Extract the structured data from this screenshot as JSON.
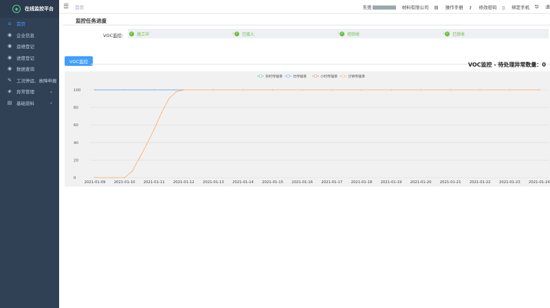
{
  "sidebar": {
    "title": "在线监控平台",
    "items": [
      {
        "label": "首页",
        "icon": "home-icon",
        "active": true
      },
      {
        "label": "企业信息",
        "icon": "eye-icon"
      },
      {
        "label": "运维登记",
        "icon": "eye-icon"
      },
      {
        "label": "进度登记",
        "icon": "eye-icon"
      },
      {
        "label": "数据查询",
        "icon": "eye-icon"
      },
      {
        "label": "工况停运、故障申报",
        "icon": "wrench-icon"
      },
      {
        "label": "异常管理",
        "icon": "cube-icon",
        "expand": true
      },
      {
        "label": "基础资料",
        "icon": "document-icon",
        "expand": true
      }
    ]
  },
  "topbar": {
    "breadcrumb": "首页",
    "company_prefix": "东莞",
    "company_suffix": "材料有限公司",
    "manual": "操作手册",
    "change_password": "修改密码",
    "bind_phone": "绑定手机",
    "logout": "退"
  },
  "progress": {
    "section_title": "监控任务进度",
    "voc_label": "VOC监控:",
    "steps": [
      "施工中",
      "已接入",
      "待验收",
      "已验收"
    ]
  },
  "tab": {
    "label": "VOC监控"
  },
  "exception": {
    "text": "VOC监控 - 待处理异常数量：0"
  },
  "chart_data": {
    "type": "line",
    "legend": [
      "实时传输率",
      "日传输率",
      "小时传输率",
      "分钟传输率"
    ],
    "legend_colors": [
      "#7fd0a2",
      "#8fb6e3",
      "#ef9a9a",
      "#f5b98a"
    ],
    "categories": [
      "2021-01-09",
      "2021-01-10",
      "2021-01-11",
      "2021-01-12",
      "2021-01-13",
      "2021-01-14",
      "2021-01-15",
      "2021-01-16",
      "2021-01-17",
      "2021-01-18",
      "2021-01-19",
      "2021-01-20",
      "2021-01-21",
      "2021-01-22",
      "2021-01-23",
      "2021-01-24"
    ],
    "ylim": [
      0,
      100
    ],
    "yticks": [
      "100",
      "80",
      "60",
      "40",
      "20",
      "0"
    ],
    "series": [
      {
        "name": "日传输率",
        "color": "#7ab0e8",
        "values": [
          100,
          100,
          100,
          100,
          100,
          100,
          100,
          100,
          100,
          100,
          100,
          100,
          100,
          100,
          100,
          100
        ]
      },
      {
        "name": "分钟传输率",
        "color": "#f5b98a",
        "x": [
          0,
          1,
          1.25,
          1.5,
          1.75,
          2,
          2.25,
          2.5,
          2.75,
          3,
          4,
          5,
          6,
          7,
          8,
          9,
          10,
          11,
          12,
          13,
          14,
          15
        ],
        "values": [
          0,
          0,
          7,
          22,
          38,
          55,
          74,
          90,
          98,
          100,
          100,
          100,
          100,
          100,
          100,
          100,
          100,
          100,
          100,
          100,
          100,
          100
        ]
      }
    ]
  }
}
